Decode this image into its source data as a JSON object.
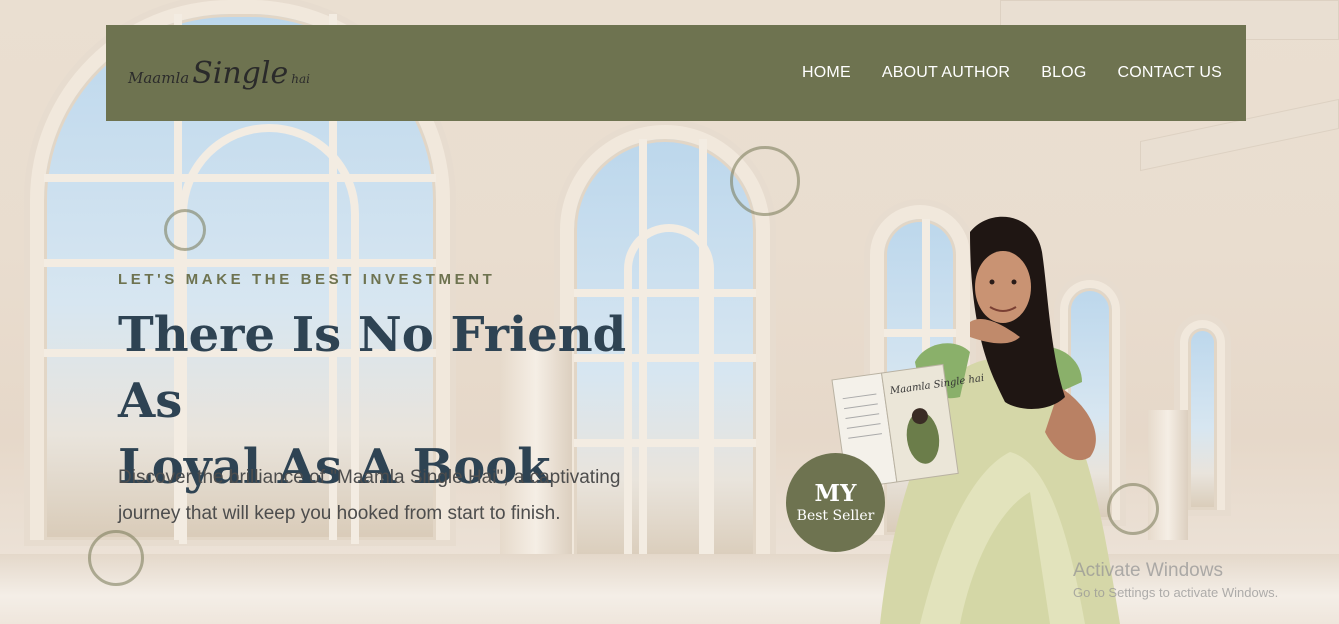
{
  "brand": {
    "logo_part1": "Maamla",
    "logo_part2": "Single",
    "logo_part3": "hai"
  },
  "nav": {
    "items": [
      {
        "label": "HOME"
      },
      {
        "label": "ABOUT AUTHOR"
      },
      {
        "label": "BLOG"
      },
      {
        "label": "CONTACT US"
      }
    ]
  },
  "hero": {
    "eyebrow": "LET'S MAKE THE BEST INVESTMENT",
    "headline_line1": "There Is No Friend As",
    "headline_line2": "Loyal As A Book",
    "lead": "Discover the brilliance of \"Maamla Single Hai\", a captivating journey that will keep you hooked from start to finish."
  },
  "badge": {
    "line1": "MY",
    "line2": "Best Seller"
  },
  "book": {
    "cover_title": "Maamla Single hai"
  },
  "watermark": {
    "line1": "Activate Windows",
    "line2": "Go to Settings to activate Windows."
  },
  "colors": {
    "olive": "#6e7350",
    "heading": "#2e4353",
    "body_text": "#4d4d4d"
  }
}
